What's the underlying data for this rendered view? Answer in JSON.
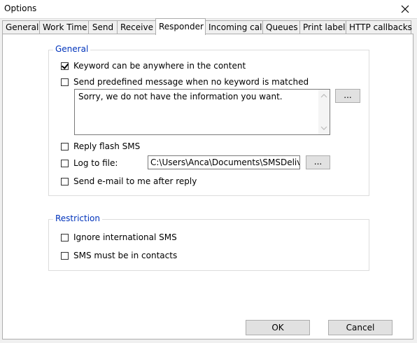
{
  "window": {
    "title": "Options"
  },
  "tabs": [
    {
      "label": "General"
    },
    {
      "label": "Work Time"
    },
    {
      "label": "Send"
    },
    {
      "label": "Receive"
    },
    {
      "label": "Responder"
    },
    {
      "label": "Incoming call"
    },
    {
      "label": "Queues"
    },
    {
      "label": "Print label"
    },
    {
      "label": "HTTP callbacks"
    }
  ],
  "active_tab": "Responder",
  "general": {
    "title": "General",
    "keyword_anywhere": {
      "label": "Keyword can be anywhere in the content",
      "checked": true
    },
    "send_predefined": {
      "label": "Send predefined message when no keyword is matched",
      "checked": false
    },
    "predefined_message": "Sorry, we do not have the information you want.",
    "browse_label": "...",
    "reply_flash": {
      "label": "Reply flash SMS",
      "checked": false
    },
    "log_to_file": {
      "label": "Log to file:",
      "checked": false
    },
    "log_path": "C:\\Users\\Anca\\Documents\\SMSDeliver[",
    "log_browse_label": "...",
    "send_email": {
      "label": "Send e-mail to me after reply",
      "checked": false
    }
  },
  "restriction": {
    "title": "Restriction",
    "ignore_international": {
      "label": "Ignore international SMS",
      "checked": false
    },
    "must_be_contacts": {
      "label": "SMS must be in contacts",
      "checked": false
    }
  },
  "buttons": {
    "ok": "OK",
    "cancel": "Cancel"
  },
  "colors": {
    "group_title": "#0033bb",
    "panel_bg": "#ffffff",
    "window_bg": "#f0f0f0"
  }
}
